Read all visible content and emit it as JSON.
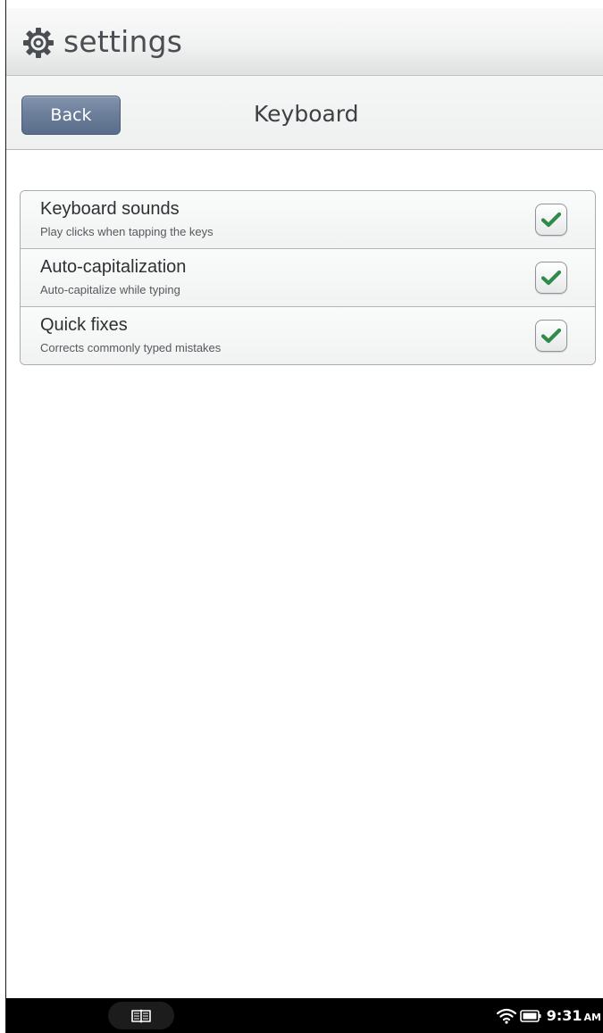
{
  "app": {
    "title": "settings",
    "icon": "gear-icon"
  },
  "navigation": {
    "back_label": "Back",
    "page_title": "Keyboard"
  },
  "settings": [
    {
      "title": "Keyboard sounds",
      "description": "Play clicks when tapping the keys",
      "checked": true
    },
    {
      "title": "Auto-capitalization",
      "description": "Auto-capitalize while typing",
      "checked": true
    },
    {
      "title": "Quick fixes",
      "description": "Corrects commonly typed mistakes",
      "checked": true
    }
  ],
  "status_bar": {
    "time": "9:31",
    "period": "AM",
    "icons": [
      "library-icon",
      "wifi-icon",
      "battery-icon"
    ]
  },
  "colors": {
    "check": "#2e8b48",
    "back_button": "#6a7d99",
    "title_text": "#4a4d51"
  }
}
